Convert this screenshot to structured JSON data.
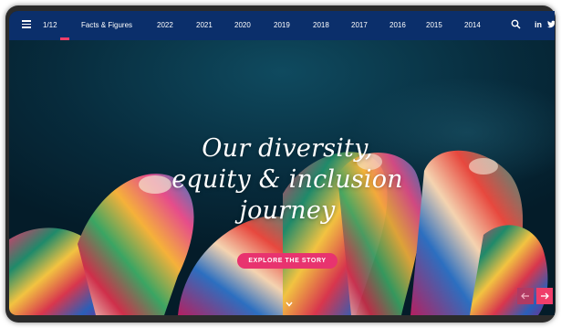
{
  "nav": {
    "page_indicator": "1/12",
    "items": [
      "Facts & Figures",
      "2022",
      "2021",
      "2020",
      "2019",
      "2018",
      "2017",
      "2016",
      "2015",
      "2014"
    ],
    "social_linkedin": "in"
  },
  "hero": {
    "headline_lines": [
      "Our diversity,",
      "equity & inclusion",
      "journey"
    ],
    "cta_label": "EXPLORE THE STORY"
  },
  "colors": {
    "nav_bg": "#0b2f6b",
    "accent": "#ef3e6a"
  },
  "icons": {
    "menu": "hamburger-menu-icon",
    "search": "search-icon",
    "linkedin": "linkedin-icon",
    "twitter": "twitter-icon",
    "scroll": "chevron-down-icon",
    "prev": "arrow-left-icon",
    "next": "arrow-right-icon"
  }
}
